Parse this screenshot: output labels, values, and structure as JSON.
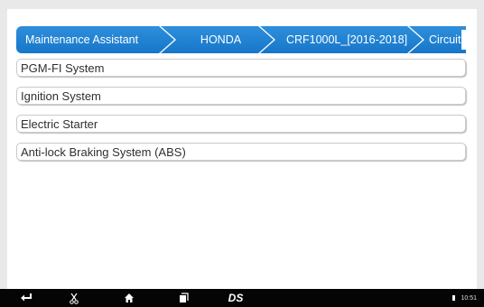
{
  "breadcrumb": [
    {
      "label": "Maintenance Assistant"
    },
    {
      "label": "HONDA"
    },
    {
      "label": "CRF1000L_[2016-2018]"
    },
    {
      "label": "Circuit D"
    }
  ],
  "systems": [
    {
      "label": "PGM-FI System"
    },
    {
      "label": "Ignition System"
    },
    {
      "label": "Electric Starter"
    },
    {
      "label": "Anti-lock Braking System (ABS)"
    }
  ],
  "navbar": {
    "back_icon": "back-arrow-icon",
    "scissors_icon": "scissors-icon",
    "home_icon": "home-icon",
    "recent_icon": "recent-apps-icon",
    "logo_text": "DS",
    "clock": "10:51"
  },
  "colors": {
    "crumb_blue": "#1e82d2",
    "navbar_bg": "#050505",
    "panel_bg": "#ffffff"
  }
}
